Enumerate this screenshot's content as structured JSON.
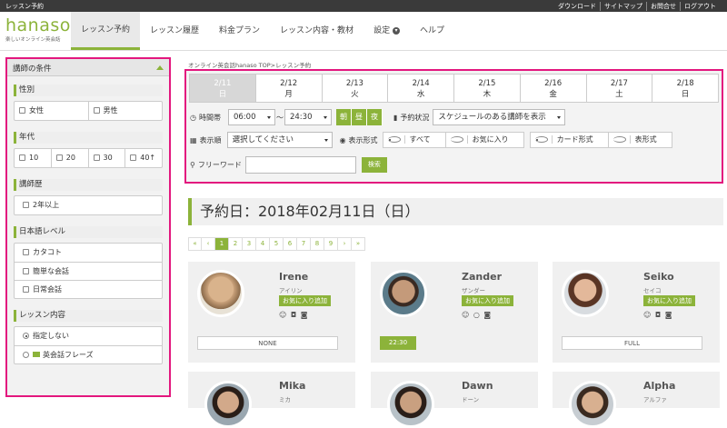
{
  "topbar": {
    "title": "レッスン予約",
    "links": [
      "ダウンロード",
      "サイトマップ",
      "お問合せ",
      "ログアウト"
    ]
  },
  "logo": {
    "word": "hanaso",
    "tagline": "楽しいオンライン英会話"
  },
  "nav": {
    "items": [
      "レッスン予約",
      "レッスン履歴",
      "料金プラン",
      "レッスン内容・教材",
      "設定",
      "ヘルプ"
    ],
    "active_index": 0
  },
  "sidebar": {
    "header": "講師の条件",
    "gender": {
      "title": "性別",
      "options": [
        "女性",
        "男性"
      ]
    },
    "age": {
      "title": "年代",
      "options": [
        "10",
        "20",
        "30",
        "40↑"
      ]
    },
    "experience": {
      "title": "講師歴",
      "options": [
        "2年以上"
      ]
    },
    "japanese": {
      "title": "日本語レベル",
      "options": [
        "カタコト",
        "簡単な会話",
        "日常会話"
      ]
    },
    "content": {
      "title": "レッスン内容",
      "options": [
        "指定しない",
        "英会話フレーズ"
      ],
      "selected": "指定しない"
    }
  },
  "breadcrumb": "オンライン英会話hanaso TOP>レッスン予約",
  "dates": [
    {
      "date": "2/11",
      "day": "日",
      "active": true
    },
    {
      "date": "2/12",
      "day": "月"
    },
    {
      "date": "2/13",
      "day": "火"
    },
    {
      "date": "2/14",
      "day": "水"
    },
    {
      "date": "2/15",
      "day": "木"
    },
    {
      "date": "2/16",
      "day": "金"
    },
    {
      "date": "2/17",
      "day": "土"
    },
    {
      "date": "2/18",
      "day": "日"
    }
  ],
  "filters": {
    "time_label": "時間帯",
    "time_from": "06:00",
    "time_sep": "～",
    "time_to": "24:30",
    "time_buttons": [
      "朝",
      "昼",
      "夜"
    ],
    "status_label": "予約状況",
    "status_value": "スケジュールのある講師を表示",
    "order_label": "表示順",
    "order_placeholder": "選択してください",
    "format_label": "表示形式",
    "scope_options": [
      "すべて",
      "お気に入り"
    ],
    "scope_selected": "すべて",
    "view_options": [
      "カード形式",
      "表形式"
    ],
    "view_selected": "カード形式",
    "keyword_label": "フリーワード",
    "keyword_value": "",
    "search_button": "検索"
  },
  "day_heading": "予約日：2018年02月11日（日）",
  "pager": [
    "«",
    "‹",
    "1",
    "2",
    "3",
    "4",
    "5",
    "6",
    "7",
    "8",
    "9",
    "›",
    "»"
  ],
  "pager_active": "1",
  "teachers": [
    {
      "name": "Irene",
      "kana": "アイリン",
      "fav": "お気に入り追加",
      "icons": "☺ ◘ ◙",
      "status": "NONE",
      "status_type": "grey"
    },
    {
      "name": "Zander",
      "kana": "ザンダー",
      "fav": "お気に入り追加",
      "icons": "☺ ○ ◙",
      "status": "22:30",
      "status_type": "green"
    },
    {
      "name": "Seiko",
      "kana": "セイコ",
      "fav": "お気に入り追加",
      "icons": "☺ ◘ ◙",
      "status": "FULL",
      "status_type": "grey"
    },
    {
      "name": "Mika",
      "kana": "ミカ"
    },
    {
      "name": "Dawn",
      "kana": "ドーン"
    },
    {
      "name": "Alpha",
      "kana": "アルファ"
    }
  ],
  "colors": {
    "accent": "#8cb33a",
    "highlight": "#e3177e",
    "topbar": "#3a3a3a"
  }
}
